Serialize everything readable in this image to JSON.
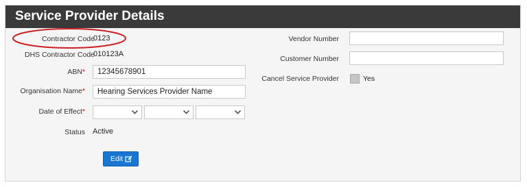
{
  "header": {
    "title": "Service Provider Details"
  },
  "left": {
    "contractor_code": {
      "label": "Contractor Code",
      "value": "0123"
    },
    "dhs_contractor_code": {
      "label": "DHS Contractor Code",
      "value": "010123A"
    },
    "abn": {
      "label": "ABN",
      "value": "12345678901",
      "required_mark": "*"
    },
    "organisation_name": {
      "label": "Organisation Name",
      "value": "Hearing Services Provider Name",
      "required_mark": "*"
    },
    "date_of_effect": {
      "label": "Date of Effect",
      "required_mark": "*"
    },
    "status": {
      "label": "Status",
      "value": "Active"
    }
  },
  "right": {
    "vendor_number": {
      "label": "Vendor Number",
      "value": ""
    },
    "customer_number": {
      "label": "Customer Number",
      "value": ""
    },
    "cancel_service_provider": {
      "label": "Cancel Service Provider",
      "option_label": "Yes"
    }
  },
  "actions": {
    "edit_label": "Edit"
  },
  "colors": {
    "header_bg": "#3a3a3a",
    "button_bg": "#1976d2",
    "required": "#cc0000",
    "annotation": "#cc1f1f"
  }
}
